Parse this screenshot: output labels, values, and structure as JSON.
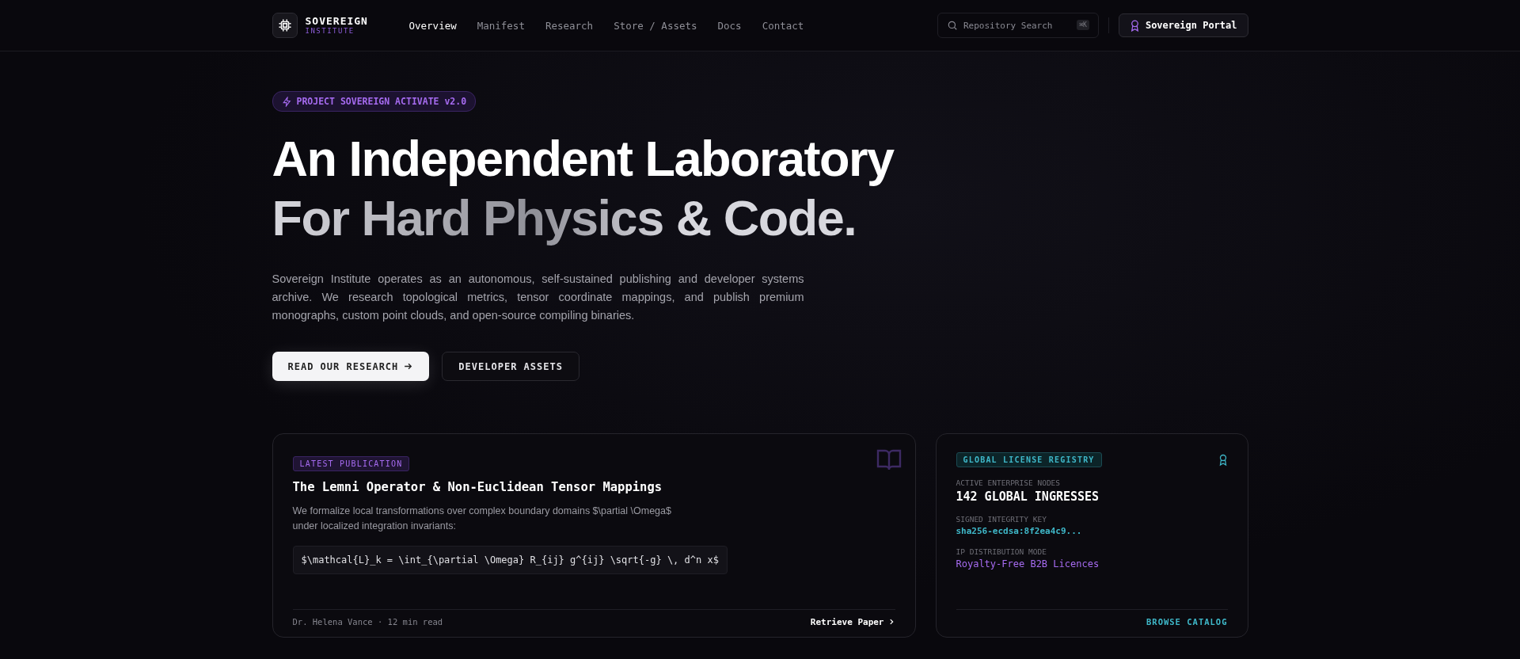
{
  "nav": {
    "brand": "SOVEREIGN",
    "brand_sub": "INSTITUTE",
    "items": [
      {
        "label": "Overview",
        "selected": true
      },
      {
        "label": "Manifest",
        "selected": false
      },
      {
        "label": "Research",
        "selected": false
      },
      {
        "label": "Store / Assets",
        "selected": false
      },
      {
        "label": "Docs",
        "selected": false
      },
      {
        "label": "Contact",
        "selected": false
      }
    ],
    "search": {
      "placeholder": "Repository Search",
      "shortcut": "⌘K"
    },
    "portal_button": "Sovereign Portal"
  },
  "hero": {
    "badge": "PROJECT SOVEREIGN ACTIVATE v2.0",
    "title_line_1": "An Independent Laboratory",
    "title_line_2": "For Hard Physics & Code.",
    "description": "Sovereign Institute operates as an autonomous, self-sustained publishing and developer systems archive. We research topological metrics, tensor coordinate mappings, and publish premium monographs, custom point clouds, and open-source compiling binaries.",
    "primary_button": "READ OUR RESEARCH",
    "secondary_button": "DEVELOPER ASSETS"
  },
  "publication_card": {
    "tag": "LATEST PUBLICATION",
    "title": "The Lemni Operator & Non-Euclidean Tensor Mappings",
    "summary": "We formalize local transformations over complex boundary domains $\\partial \\Omega$\nunder localized integration invariants:",
    "formula": "$\\mathcal{L}_k = \\int_{\\partial \\Omega} R_{ij} g^{ij} \\sqrt{-g} \\, d^n x$",
    "author": "Dr. Helena Vance · 12 min read",
    "link": "Retrieve Paper"
  },
  "registry_card": {
    "tag": "GLOBAL LICENSE REGISTRY",
    "fields": [
      {
        "label": "ACTIVE ENTERPRISE NODES",
        "value": "142 GLOBAL INGRESSES",
        "kind": "headline"
      },
      {
        "label": "SIGNED INTEGRITY KEY",
        "value": "sha256-ecdsa:8f2ea4c9...",
        "kind": "key"
      },
      {
        "label": "IP DISTRIBUTION MODE",
        "value": "Royalty-Free B2B Licences",
        "kind": "mode"
      }
    ],
    "link": "BROWSE CATALOG"
  }
}
